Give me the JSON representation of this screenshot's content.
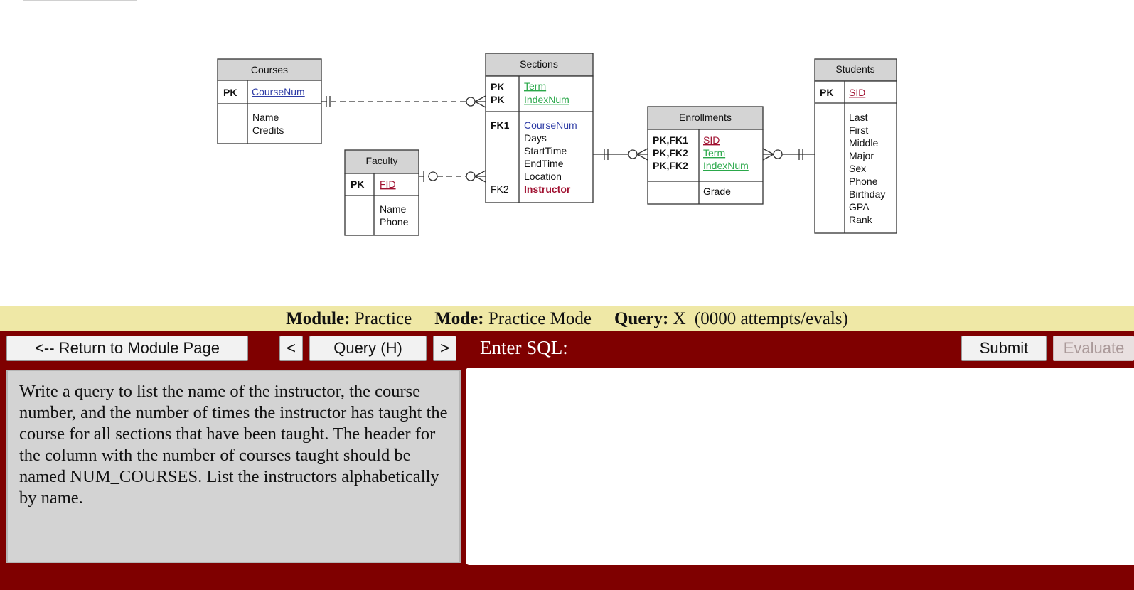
{
  "erd": {
    "courses": {
      "title": "Courses",
      "pk_key": "PK",
      "pk_field": "CourseNum",
      "attrs": [
        "Name",
        "Credits"
      ]
    },
    "sections": {
      "title": "Sections",
      "pk_keys": [
        "PK",
        "PK"
      ],
      "pk_fields": [
        "Term",
        "IndexNum"
      ],
      "fk1_key": "FK1",
      "fk1_field": "CourseNum",
      "attrs": [
        "Days",
        "StartTime",
        "EndTime",
        "Location"
      ],
      "fk2_key": "FK2",
      "fk2_field": "Instructor"
    },
    "faculty": {
      "title": "Faculty",
      "pk_key": "PK",
      "pk_field": "FID",
      "attrs": [
        "Name",
        "Phone"
      ]
    },
    "enrollments": {
      "title": "Enrollments",
      "keys": [
        "PK,FK1",
        "PK,FK2",
        "PK,FK2"
      ],
      "fields": [
        "SID",
        "Term",
        "IndexNum"
      ],
      "attrs": [
        "Grade"
      ]
    },
    "students": {
      "title": "Students",
      "pk_key": "PK",
      "pk_field": "SID",
      "attrs": [
        "Last",
        "First",
        "Middle",
        "Major",
        "Sex",
        "Phone",
        "Birthday",
        "GPA",
        "Rank"
      ]
    }
  },
  "status": {
    "module_label": "Module:",
    "module_value": "Practice",
    "mode_label": "Mode:",
    "mode_value": "Practice Mode",
    "query_label": "Query:",
    "query_value": "X",
    "attempts": "(0000 attempts/evals)"
  },
  "toolbar": {
    "return_label": "<-- Return to Module Page",
    "prev_label": "<",
    "query_select": "Query (H)",
    "next_label": ">",
    "sql_label": "Enter SQL:",
    "submit_label": "Submit",
    "evaluate_label": "Evaluate"
  },
  "question": {
    "text": "Write a query to list the name of the instructor, the course number, and the number of times the instructor has taught the course for all sections that have been taught. The header for the column with the number of courses taught should be named NUM_COURSES. List the instructors alphabetically by name."
  },
  "sql": {
    "value": ""
  },
  "colors": {
    "header_fill": "#d4d4d4",
    "link_blue": "#2f3da6",
    "pk_green": "#2aa84a",
    "fk_red": "#a01030",
    "panel": "#7f0000",
    "status_bar": "#efe8a6"
  }
}
